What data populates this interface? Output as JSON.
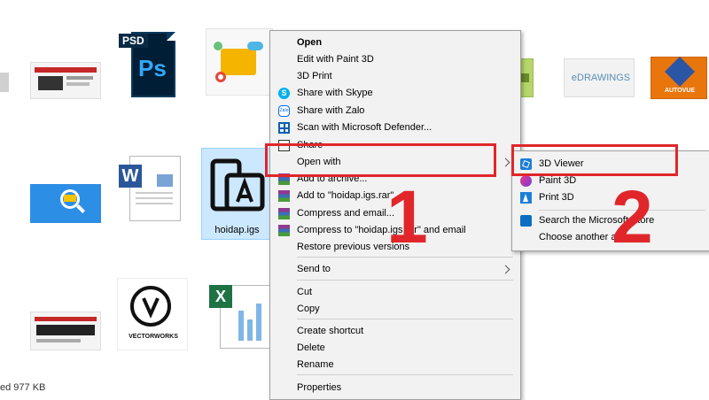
{
  "files": {
    "selected_name": "hoidap.igs",
    "psd_badge": "PSD",
    "psd_text": "Ps",
    "vectorworks_text": "VECTORWORKS",
    "edrawings_text": "eDRAWINGS",
    "autovue_text": "AUTOVUE"
  },
  "status_bar": {
    "text": "ed  977 KB"
  },
  "context_menu": {
    "items": [
      {
        "label": "Open",
        "icon": "none",
        "bold": true
      },
      {
        "label": "Edit with Paint 3D",
        "icon": "none"
      },
      {
        "label": "3D Print",
        "icon": "none"
      },
      {
        "label": "Share with Skype",
        "icon": "skype-icon"
      },
      {
        "label": "Share with Zalo",
        "icon": "zalo-icon"
      },
      {
        "label": "Scan with Microsoft Defender...",
        "icon": "defender-icon"
      },
      {
        "label": "Share",
        "icon": "share-icon"
      },
      {
        "label": "Open with",
        "icon": "none",
        "submenu": true
      },
      {
        "label": "Add to archive...",
        "icon": "winrar-icon"
      },
      {
        "label": "Add to \"hoidap.igs.rar\"",
        "icon": "winrar-icon"
      },
      {
        "label": "Compress and email...",
        "icon": "winrar-icon"
      },
      {
        "label": "Compress to \"hoidap.igs.rar\" and email",
        "icon": "winrar-icon"
      },
      {
        "label": "Restore previous versions",
        "icon": "none"
      },
      {
        "label": "Send to",
        "icon": "none",
        "submenu": true
      },
      {
        "label": "Cut",
        "icon": "none"
      },
      {
        "label": "Copy",
        "icon": "none"
      },
      {
        "label": "Create shortcut",
        "icon": "none"
      },
      {
        "label": "Delete",
        "icon": "none"
      },
      {
        "label": "Rename",
        "icon": "none"
      },
      {
        "label": "Properties",
        "icon": "none"
      }
    ]
  },
  "open_with_submenu": {
    "items": [
      {
        "label": "3D Viewer",
        "icon": "3d-viewer-icon"
      },
      {
        "label": "Paint 3D",
        "icon": "paint-3d-icon"
      },
      {
        "label": "Print 3D",
        "icon": "print-3d-icon"
      },
      {
        "label": "Search the Microsoft Store",
        "icon": "store-icon"
      },
      {
        "label": "Choose another app",
        "icon": "none"
      }
    ]
  },
  "annotations": {
    "step1": "1",
    "step2": "2"
  },
  "colors": {
    "highlight_red": "#e0262b",
    "menu_bg": "#f2f2f2",
    "selection_bg": "#cce8ff",
    "ps_blue": "#001e36",
    "ps_cyan": "#31a8ff"
  }
}
